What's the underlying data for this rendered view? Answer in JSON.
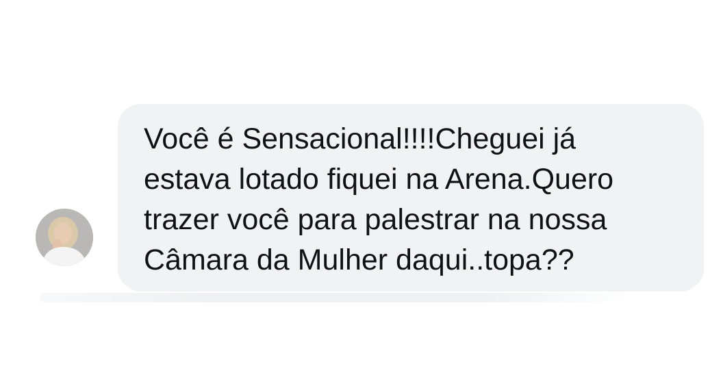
{
  "message": {
    "text": "Você é Sensacional!!!!Cheguei já\nestava lotado fiquei na Arena.Quero\ntrazer você para palestrar na nossa\nCâmara da Mulher daqui..topa??",
    "bubble_color": "#f1f2f4",
    "text_color": "#101114"
  },
  "sender": {
    "avatar_icon": "user-avatar-photo"
  }
}
